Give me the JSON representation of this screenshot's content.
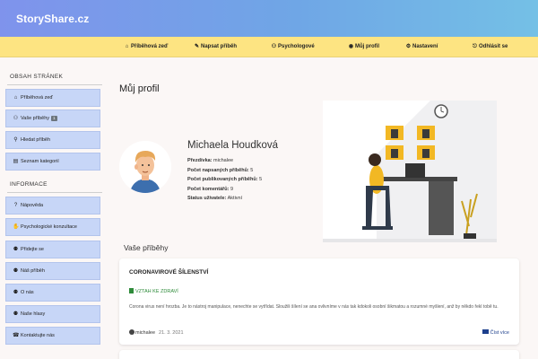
{
  "brand": "StoryShare.cz",
  "nav": {
    "stories": "Příběhová zeď",
    "write": "Napsat příběh",
    "psychologists": "Psychologové",
    "profile": "Můj profil",
    "settings": "Nastavení",
    "logout": "Odhlásit se"
  },
  "sidebar": {
    "heading_content": "OBSAH STRÁNEK",
    "content_items": [
      {
        "label": "Příběhová zeď",
        "icon": "home-icon"
      },
      {
        "label": "Vaše příběhy",
        "icon": "users-icon",
        "badge": "1"
      },
      {
        "label": "Hledat příběh",
        "icon": "search-icon"
      },
      {
        "label": "Seznam kategorií",
        "icon": "list-icon"
      }
    ],
    "heading_info": "INFORMACE",
    "info_items": [
      {
        "label": "Nápověda",
        "icon": "question-icon"
      },
      {
        "label": "Psychologické konzultace",
        "icon": "handshake-icon"
      },
      {
        "label": "Přidejte se",
        "icon": "user-plus-icon"
      },
      {
        "label": "Náš příběh",
        "icon": "user-icon"
      },
      {
        "label": "O nás",
        "icon": "user-icon"
      },
      {
        "label": "Naše hlasy",
        "icon": "user-icon"
      },
      {
        "label": "Kontaktujte nás",
        "icon": "address-book-icon"
      }
    ]
  },
  "page_title": "Můj profil",
  "profile": {
    "name": "Michaela Houdková",
    "nickname_label": "Přezdívka:",
    "nickname_value": "michalee",
    "written_label": "Počet napsaných příběhů:",
    "written_value": "5",
    "published_label": "Počet publikovaných příběhů:",
    "published_value": "5",
    "comments_label": "Počet komentářů:",
    "comments_value": "9",
    "status_label": "Status uživatele:",
    "status_value": "Aktivní"
  },
  "stories_title": "Vaše příběhy",
  "story": {
    "title": "CORONAVIROVÉ ŠÍLENSTVÍ",
    "tag": "VZTAH KE ZDRAVÍ",
    "tag_color": "#2e8b3a",
    "text": "Corona virus není hrozba. Je to nástroj manipulace, nenechte se vytřídat. Sloužili šílení se ana ovlivníme v nás tak kdokoli osobní šikmatou a rozumné myšlení, anž by někdo řekl tobě tu.",
    "author": "michalee",
    "date": "21. 3. 2021",
    "read_label": "Číst více"
  },
  "colors": {
    "sidebar_button": "#c7d6f7",
    "navbar": "#fde482",
    "header_gradient_start": "#7f93ec",
    "header_gradient_end": "#74c0e6"
  }
}
